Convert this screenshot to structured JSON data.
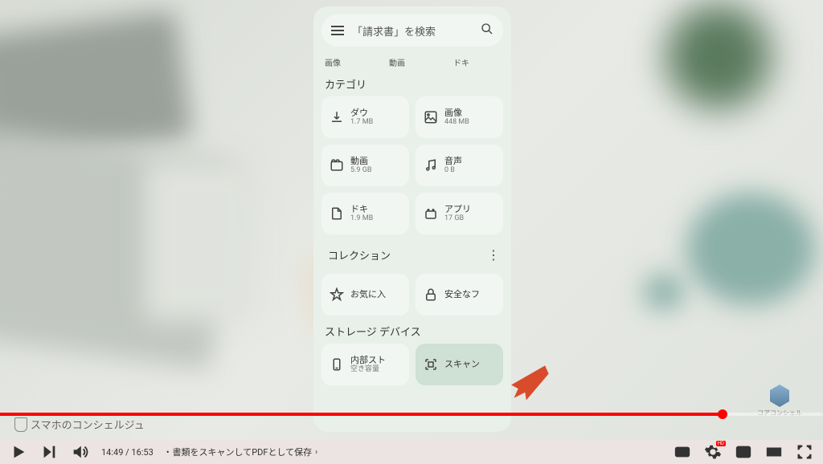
{
  "search": {
    "placeholder": "「請求書」を検索"
  },
  "filters": {
    "images": "画像",
    "videos": "動画",
    "other": "ドキ"
  },
  "sections": {
    "categories": "カテゴリ",
    "collections": "コレクション",
    "storage": "ストレージ デバイス"
  },
  "tiles": {
    "downloads": {
      "label": "ダウ",
      "sub": "1.7 MB"
    },
    "images": {
      "label": "画像",
      "sub": "448 MB"
    },
    "videos": {
      "label": "動画",
      "sub": "5.9 GB"
    },
    "audio": {
      "label": "音声",
      "sub": "0 B"
    },
    "docs": {
      "label": "ドキ",
      "sub": "1.9 MB"
    },
    "apps": {
      "label": "アプリ",
      "sub": "17 GB"
    }
  },
  "collections": {
    "favorites": "お気に入",
    "safe": "安全なフ"
  },
  "storage": {
    "internal": {
      "label": "内部スト",
      "sub": "空き容量"
    },
    "scan": "スキャン"
  },
  "watermark": "スマホのコンシェルジュ",
  "corner_logo": "コアコンシェル",
  "player": {
    "current": "14:49",
    "duration": "16:53",
    "chapter": "書類をスキャンしてPDFとして保存",
    "hd": "HD"
  }
}
